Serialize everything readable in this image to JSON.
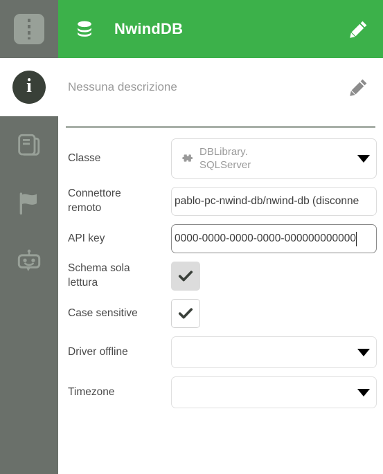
{
  "window": {
    "title": "NwindDB",
    "accent_green": "#3cb14a",
    "rail_gray": "#6a706a",
    "info_dark": "#394038"
  },
  "rail": {
    "items": [
      {
        "name": "panel-toggle",
        "icon": "split-panel-icon",
        "label": ""
      },
      {
        "name": "info",
        "icon": "info-icon",
        "label": ""
      },
      {
        "name": "documentation",
        "icon": "book-icon",
        "label": ""
      },
      {
        "name": "flag",
        "icon": "flag-icon",
        "label": ""
      },
      {
        "name": "bot",
        "icon": "robot-icon",
        "label": ""
      }
    ]
  },
  "titlebar": {
    "db_icon": "database-icon",
    "title": "NwindDB",
    "edit_icon": "pencil-icon"
  },
  "description": {
    "info_glyph": "i",
    "placeholder": "Nessuna descrizione",
    "edit_icon": "pencil-icon"
  },
  "form": {
    "rows": [
      {
        "label": "Classe",
        "control": "select",
        "value": "DBLibrary.\nSQLServer",
        "value_line1": "DBLibrary.",
        "value_line2": "SQLServer",
        "icon": "puzzle-piece-icon",
        "caret": "chevron-down-icon"
      },
      {
        "label": "Connettore remoto",
        "label_line1": "Connettore",
        "label_line2": "remoto",
        "control": "text",
        "value": "pablo-pc-nwind-db/nwind-db (disconne",
        "focused": false
      },
      {
        "label": "API key",
        "control": "text",
        "value": "0000-0000-0000-0000-000000000000",
        "focused": true
      },
      {
        "label": "Schema sola lettura",
        "label_line1": "Schema sola",
        "label_line2": "lettura",
        "control": "checkbox",
        "checked": true,
        "style": "filled"
      },
      {
        "label": "Case sensitive",
        "control": "checkbox",
        "checked": true,
        "style": "outlined"
      },
      {
        "label": "Driver offline",
        "control": "select",
        "value": "",
        "caret": "chevron-down-icon"
      },
      {
        "label": "Timezone",
        "control": "select",
        "value": "",
        "caret": "chevron-down-icon"
      }
    ]
  }
}
